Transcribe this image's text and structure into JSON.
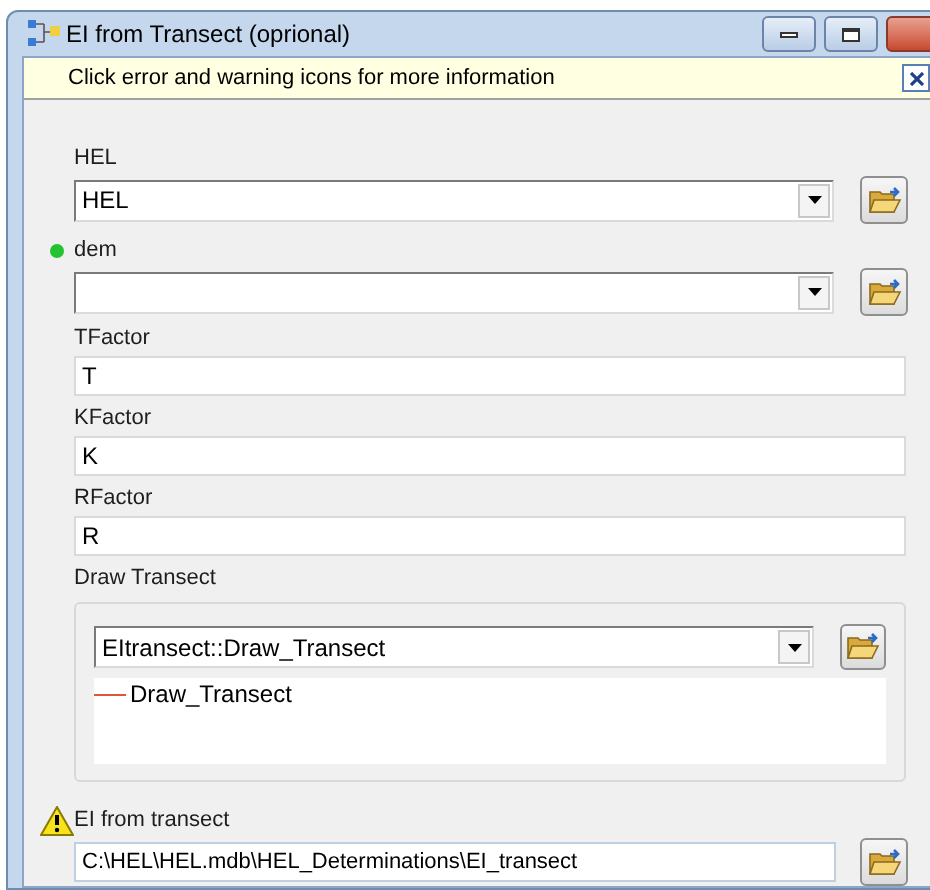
{
  "window": {
    "title": "EI from Transect (oprional)"
  },
  "info_bar": {
    "message": "Click error and warning icons for more information"
  },
  "parameters": [
    {
      "kind": "combo",
      "label": "HEL",
      "value": "HEL",
      "required": false,
      "warning": false
    },
    {
      "kind": "combo",
      "label": "dem",
      "required": true,
      "warning": false
    },
    {
      "kind": "text",
      "label": "TFactor",
      "value": "T",
      "required": false,
      "warning": false
    },
    {
      "kind": "text",
      "label": "KFactor",
      "value": "K",
      "required": false,
      "warning": false
    },
    {
      "kind": "text",
      "label": "RFactor",
      "value": "R",
      "required": false,
      "warning": false
    },
    {
      "kind": "featureset",
      "label": "Draw Transect",
      "value": "EItransect::Draw_Transect",
      "items": [
        "Draw_Transect"
      ],
      "required": false,
      "warning": false
    },
    {
      "kind": "output",
      "label": "EI from transect",
      "value": "C:\\HEL\\HEL.mdb\\HEL_Determinations\\EI_transect",
      "required": false,
      "warning": true
    }
  ]
}
